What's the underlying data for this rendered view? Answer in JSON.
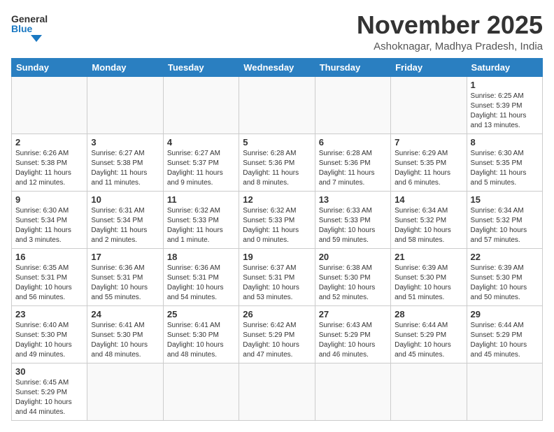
{
  "header": {
    "logo_general": "General",
    "logo_blue": "Blue",
    "month_title": "November 2025",
    "subtitle": "Ashoknagar, Madhya Pradesh, India"
  },
  "weekdays": [
    "Sunday",
    "Monday",
    "Tuesday",
    "Wednesday",
    "Thursday",
    "Friday",
    "Saturday"
  ],
  "weeks": [
    [
      {
        "day": "",
        "info": ""
      },
      {
        "day": "",
        "info": ""
      },
      {
        "day": "",
        "info": ""
      },
      {
        "day": "",
        "info": ""
      },
      {
        "day": "",
        "info": ""
      },
      {
        "day": "",
        "info": ""
      },
      {
        "day": "1",
        "info": "Sunrise: 6:25 AM\nSunset: 5:39 PM\nDaylight: 11 hours\nand 13 minutes."
      }
    ],
    [
      {
        "day": "2",
        "info": "Sunrise: 6:26 AM\nSunset: 5:38 PM\nDaylight: 11 hours\nand 12 minutes."
      },
      {
        "day": "3",
        "info": "Sunrise: 6:27 AM\nSunset: 5:38 PM\nDaylight: 11 hours\nand 11 minutes."
      },
      {
        "day": "4",
        "info": "Sunrise: 6:27 AM\nSunset: 5:37 PM\nDaylight: 11 hours\nand 9 minutes."
      },
      {
        "day": "5",
        "info": "Sunrise: 6:28 AM\nSunset: 5:36 PM\nDaylight: 11 hours\nand 8 minutes."
      },
      {
        "day": "6",
        "info": "Sunrise: 6:28 AM\nSunset: 5:36 PM\nDaylight: 11 hours\nand 7 minutes."
      },
      {
        "day": "7",
        "info": "Sunrise: 6:29 AM\nSunset: 5:35 PM\nDaylight: 11 hours\nand 6 minutes."
      },
      {
        "day": "8",
        "info": "Sunrise: 6:30 AM\nSunset: 5:35 PM\nDaylight: 11 hours\nand 5 minutes."
      }
    ],
    [
      {
        "day": "9",
        "info": "Sunrise: 6:30 AM\nSunset: 5:34 PM\nDaylight: 11 hours\nand 3 minutes."
      },
      {
        "day": "10",
        "info": "Sunrise: 6:31 AM\nSunset: 5:34 PM\nDaylight: 11 hours\nand 2 minutes."
      },
      {
        "day": "11",
        "info": "Sunrise: 6:32 AM\nSunset: 5:33 PM\nDaylight: 11 hours\nand 1 minute."
      },
      {
        "day": "12",
        "info": "Sunrise: 6:32 AM\nSunset: 5:33 PM\nDaylight: 11 hours\nand 0 minutes."
      },
      {
        "day": "13",
        "info": "Sunrise: 6:33 AM\nSunset: 5:33 PM\nDaylight: 10 hours\nand 59 minutes."
      },
      {
        "day": "14",
        "info": "Sunrise: 6:34 AM\nSunset: 5:32 PM\nDaylight: 10 hours\nand 58 minutes."
      },
      {
        "day": "15",
        "info": "Sunrise: 6:34 AM\nSunset: 5:32 PM\nDaylight: 10 hours\nand 57 minutes."
      }
    ],
    [
      {
        "day": "16",
        "info": "Sunrise: 6:35 AM\nSunset: 5:31 PM\nDaylight: 10 hours\nand 56 minutes."
      },
      {
        "day": "17",
        "info": "Sunrise: 6:36 AM\nSunset: 5:31 PM\nDaylight: 10 hours\nand 55 minutes."
      },
      {
        "day": "18",
        "info": "Sunrise: 6:36 AM\nSunset: 5:31 PM\nDaylight: 10 hours\nand 54 minutes."
      },
      {
        "day": "19",
        "info": "Sunrise: 6:37 AM\nSunset: 5:31 PM\nDaylight: 10 hours\nand 53 minutes."
      },
      {
        "day": "20",
        "info": "Sunrise: 6:38 AM\nSunset: 5:30 PM\nDaylight: 10 hours\nand 52 minutes."
      },
      {
        "day": "21",
        "info": "Sunrise: 6:39 AM\nSunset: 5:30 PM\nDaylight: 10 hours\nand 51 minutes."
      },
      {
        "day": "22",
        "info": "Sunrise: 6:39 AM\nSunset: 5:30 PM\nDaylight: 10 hours\nand 50 minutes."
      }
    ],
    [
      {
        "day": "23",
        "info": "Sunrise: 6:40 AM\nSunset: 5:30 PM\nDaylight: 10 hours\nand 49 minutes."
      },
      {
        "day": "24",
        "info": "Sunrise: 6:41 AM\nSunset: 5:30 PM\nDaylight: 10 hours\nand 48 minutes."
      },
      {
        "day": "25",
        "info": "Sunrise: 6:41 AM\nSunset: 5:30 PM\nDaylight: 10 hours\nand 48 minutes."
      },
      {
        "day": "26",
        "info": "Sunrise: 6:42 AM\nSunset: 5:29 PM\nDaylight: 10 hours\nand 47 minutes."
      },
      {
        "day": "27",
        "info": "Sunrise: 6:43 AM\nSunset: 5:29 PM\nDaylight: 10 hours\nand 46 minutes."
      },
      {
        "day": "28",
        "info": "Sunrise: 6:44 AM\nSunset: 5:29 PM\nDaylight: 10 hours\nand 45 minutes."
      },
      {
        "day": "29",
        "info": "Sunrise: 6:44 AM\nSunset: 5:29 PM\nDaylight: 10 hours\nand 45 minutes."
      }
    ],
    [
      {
        "day": "30",
        "info": "Sunrise: 6:45 AM\nSunset: 5:29 PM\nDaylight: 10 hours\nand 44 minutes."
      },
      {
        "day": "",
        "info": ""
      },
      {
        "day": "",
        "info": ""
      },
      {
        "day": "",
        "info": ""
      },
      {
        "day": "",
        "info": ""
      },
      {
        "day": "",
        "info": ""
      },
      {
        "day": "",
        "info": ""
      }
    ]
  ]
}
